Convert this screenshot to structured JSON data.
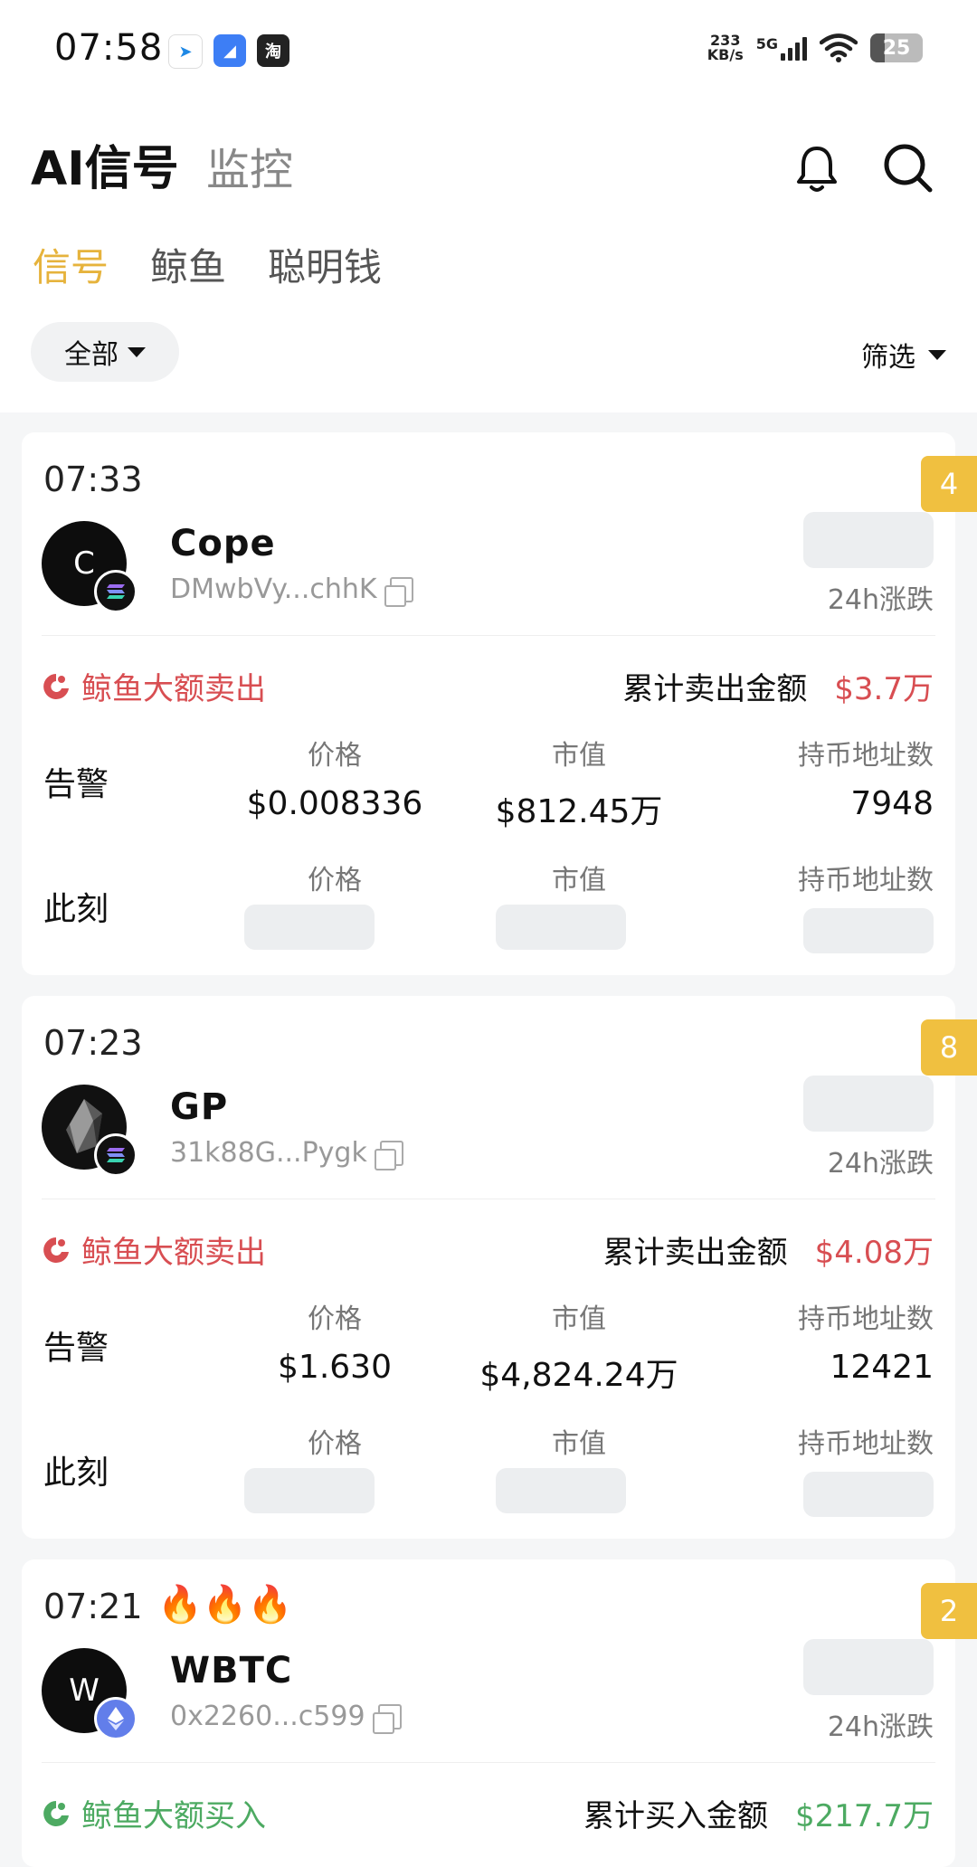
{
  "status_bar": {
    "time": "07:58",
    "net_speed_value": "233",
    "net_speed_unit": "KB/s",
    "network": "5G",
    "battery": "25"
  },
  "header": {
    "title": "AI信号",
    "monitor_tab": "监控"
  },
  "subtabs": [
    {
      "label": "信号",
      "active": true
    },
    {
      "label": "鲸鱼"
    },
    {
      "label": "聪明钱"
    }
  ],
  "filters": {
    "all": "全部",
    "filter": "筛选"
  },
  "labels": {
    "change_24h": "24h涨跌",
    "alert": "告警",
    "now": "此刻",
    "price": "价格",
    "market_cap": "市值",
    "holders": "持币地址数"
  },
  "cards": [
    {
      "time": "07:33",
      "badge": "4",
      "avatar_letter": "C",
      "name": "Cope",
      "address": "DMwbVy...chhK",
      "chain": "solana",
      "event": "鲸鱼大额卖出",
      "sum_label": "累计卖出金额",
      "sum_value": "$3.7万",
      "alert_price": "$0.008336",
      "alert_mcap": "$812.45万",
      "alert_holders": "7948"
    },
    {
      "time": "07:23",
      "badge": "8",
      "avatar_letter": "",
      "name": "GP",
      "address": "31k88G...Pygk",
      "chain": "solana",
      "event": "鲸鱼大额卖出",
      "sum_label": "累计卖出金额",
      "sum_value": "$4.08万",
      "alert_price": "$1.630",
      "alert_mcap": "$4,824.24万",
      "alert_holders": "12421"
    },
    {
      "time": "07:21",
      "fires": "🔥🔥🔥",
      "badge": "2",
      "avatar_letter": "W",
      "name": "WBTC",
      "address": "0x2260...c599",
      "chain": "ethereum",
      "event": "鲸鱼大额买入",
      "sum_label": "累计买入金额",
      "sum_value": "$217.7万"
    }
  ],
  "colors": {
    "accent": "#e6b33c",
    "sell": "#d84e52",
    "buy": "#4daa62",
    "badge": "#f0c040"
  }
}
